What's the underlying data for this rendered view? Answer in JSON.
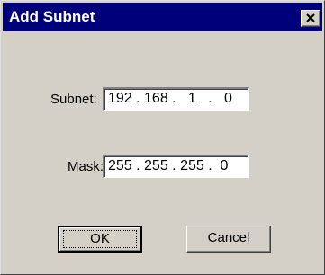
{
  "window": {
    "title": "Add Subnet",
    "close_icon": "close-x-icon"
  },
  "form": {
    "subnet_label": "Subnet:",
    "subnet_value": "192 . 168 .   1   .   0",
    "mask_label": "Mask:",
    "mask_value": "255 . 255 . 255 .  0"
  },
  "buttons": {
    "ok_label": "OK",
    "cancel_label": "Cancel"
  },
  "colors": {
    "titlebar": "#00007b",
    "face": "#d4d0c8"
  }
}
